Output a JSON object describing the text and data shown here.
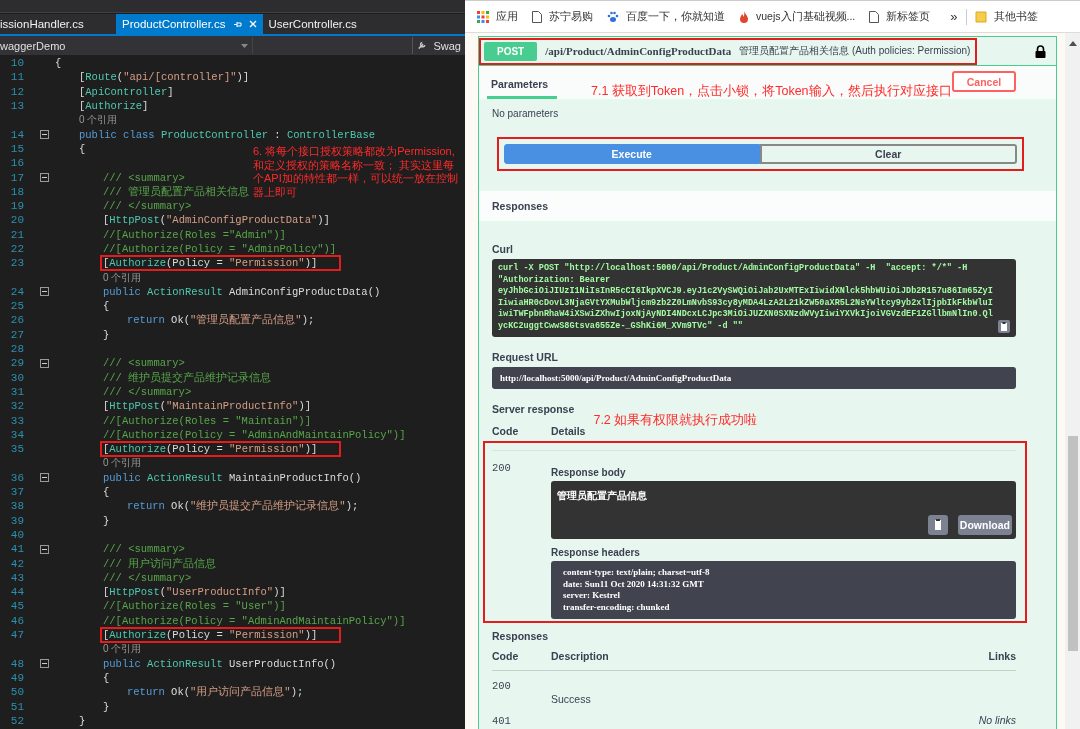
{
  "editor": {
    "tabs": [
      {
        "label": "issionHandler.cs",
        "selected": false
      },
      {
        "label": "ProductController.cs",
        "selected": true
      },
      {
        "label": "UserController.cs",
        "selected": false
      }
    ],
    "nav": {
      "project": "waggerDemo",
      "member": "Swag"
    },
    "note": "6. 将每个接口授权策略都改为Permission,和定义授权的策略名称一致； 其实这里每个API加的特性都一样，可以统一放在控制器上即可",
    "lines": [
      {
        "kind": "code",
        "number": "10",
        "fold": false,
        "highlighted": false,
        "tokens": [
          {
            "kind": "p",
            "text": "{"
          }
        ]
      },
      {
        "kind": "code",
        "number": "11",
        "fold": false,
        "highlighted": false,
        "tokens": [
          {
            "kind": "p",
            "text": "    ["
          },
          {
            "kind": "type",
            "text": "Route"
          },
          {
            "kind": "p",
            "text": "("
          },
          {
            "kind": "str",
            "text": "\"api/[controller]\""
          },
          {
            "kind": "p",
            "text": ")]"
          }
        ]
      },
      {
        "kind": "code",
        "number": "12",
        "fold": false,
        "highlighted": false,
        "tokens": [
          {
            "kind": "p",
            "text": "    ["
          },
          {
            "kind": "type",
            "text": "ApiController"
          },
          {
            "kind": "p",
            "text": "]"
          }
        ]
      },
      {
        "kind": "code",
        "number": "13",
        "fold": false,
        "highlighted": false,
        "tokens": [
          {
            "kind": "p",
            "text": "    ["
          },
          {
            "kind": "type",
            "text": "Authorize"
          },
          {
            "kind": "p",
            "text": "]"
          }
        ]
      },
      {
        "kind": "lens",
        "text": "    0 个引用"
      },
      {
        "kind": "code",
        "number": "14",
        "fold": true,
        "highlighted": false,
        "tokens": [
          {
            "kind": "kw",
            "text": "    public class "
          },
          {
            "kind": "type",
            "text": "ProductController"
          },
          {
            "kind": "p",
            "text": " : "
          },
          {
            "kind": "type",
            "text": "ControllerBase"
          }
        ]
      },
      {
        "kind": "code",
        "number": "15",
        "fold": false,
        "highlighted": false,
        "tokens": [
          {
            "kind": "p",
            "text": "    {"
          }
        ]
      },
      {
        "kind": "code",
        "number": "16",
        "fold": false,
        "highlighted": false
      },
      {
        "kind": "code",
        "number": "17",
        "fold": true,
        "highlighted": false,
        "tokens": [
          {
            "kind": "cm",
            "text": "        /// <summary>"
          }
        ]
      },
      {
        "kind": "code",
        "number": "18",
        "fold": false,
        "highlighted": false,
        "tokens": [
          {
            "kind": "cm",
            "text": "        /// 管理员配置产品相关信息"
          }
        ]
      },
      {
        "kind": "code",
        "number": "19",
        "fold": false,
        "highlighted": false,
        "tokens": [
          {
            "kind": "cm",
            "text": "        /// </summary>"
          }
        ]
      },
      {
        "kind": "code",
        "number": "20",
        "fold": false,
        "highlighted": false,
        "tokens": [
          {
            "kind": "p",
            "text": "        ["
          },
          {
            "kind": "type",
            "text": "HttpPost"
          },
          {
            "kind": "p",
            "text": "("
          },
          {
            "kind": "str",
            "text": "\"AdminConfigProductData\""
          },
          {
            "kind": "p",
            "text": ")]"
          }
        ]
      },
      {
        "kind": "code",
        "number": "21",
        "fold": false,
        "highlighted": false,
        "tokens": [
          {
            "kind": "cm",
            "text": "        //[Authorize(Roles =\"Admin\")]"
          }
        ]
      },
      {
        "kind": "code",
        "number": "22",
        "fold": false,
        "highlighted": false,
        "tokens": [
          {
            "kind": "cm",
            "text": "        //[Authorize(Policy = \"AdminPolicy\")]"
          }
        ]
      },
      {
        "kind": "code",
        "number": "23",
        "fold": false,
        "highlighted": true,
        "tokens": [
          {
            "kind": "p",
            "text": "        ["
          },
          {
            "kind": "type",
            "text": "Authorize"
          },
          {
            "kind": "p",
            "text": "(Policy = "
          },
          {
            "kind": "str",
            "text": "\"Permission\""
          },
          {
            "kind": "p",
            "text": ")]"
          }
        ]
      },
      {
        "kind": "lens",
        "text": "        0 个引用"
      },
      {
        "kind": "code",
        "number": "24",
        "fold": true,
        "highlighted": false,
        "tokens": [
          {
            "kind": "kw",
            "text": "        public "
          },
          {
            "kind": "type",
            "text": "ActionResult "
          },
          {
            "kind": "p",
            "text": "AdminConfigProductData()"
          }
        ]
      },
      {
        "kind": "code",
        "number": "25",
        "fold": false,
        "highlighted": false,
        "tokens": [
          {
            "kind": "p",
            "text": "        {"
          }
        ]
      },
      {
        "kind": "code",
        "number": "26",
        "fold": false,
        "highlighted": false,
        "tokens": [
          {
            "kind": "kw",
            "text": "            return "
          },
          {
            "kind": "p",
            "text": "Ok("
          },
          {
            "kind": "str",
            "text": "\"管理员配置产品信息\""
          },
          {
            "kind": "p",
            "text": ");"
          }
        ]
      },
      {
        "kind": "code",
        "number": "27",
        "fold": false,
        "highlighted": false,
        "tokens": [
          {
            "kind": "p",
            "text": "        }"
          }
        ]
      },
      {
        "kind": "code",
        "number": "28",
        "fold": false,
        "highlighted": false
      },
      {
        "kind": "code",
        "number": "29",
        "fold": true,
        "highlighted": false,
        "tokens": [
          {
            "kind": "cm",
            "text": "        /// <summary>"
          }
        ]
      },
      {
        "kind": "code",
        "number": "30",
        "fold": false,
        "highlighted": false,
        "tokens": [
          {
            "kind": "cm",
            "text": "        /// 维护员提交产品维护记录信息"
          }
        ]
      },
      {
        "kind": "code",
        "number": "31",
        "fold": false,
        "highlighted": false,
        "tokens": [
          {
            "kind": "cm",
            "text": "        /// </summary>"
          }
        ]
      },
      {
        "kind": "code",
        "number": "32",
        "fold": false,
        "highlighted": false,
        "tokens": [
          {
            "kind": "p",
            "text": "        ["
          },
          {
            "kind": "type",
            "text": "HttpPost"
          },
          {
            "kind": "p",
            "text": "("
          },
          {
            "kind": "str",
            "text": "\"MaintainProductInfo\""
          },
          {
            "kind": "p",
            "text": ")]"
          }
        ]
      },
      {
        "kind": "code",
        "number": "33",
        "fold": false,
        "highlighted": false,
        "tokens": [
          {
            "kind": "cm",
            "text": "        //[Authorize(Roles = \"Maintain\")]"
          }
        ]
      },
      {
        "kind": "code",
        "number": "34",
        "fold": false,
        "highlighted": false,
        "tokens": [
          {
            "kind": "cm",
            "text": "        //[Authorize(Policy = \"AdminAndMaintainPolicy\")]"
          }
        ]
      },
      {
        "kind": "code",
        "number": "35",
        "fold": false,
        "highlighted": true,
        "tokens": [
          {
            "kind": "p",
            "text": "        ["
          },
          {
            "kind": "type",
            "text": "Authorize"
          },
          {
            "kind": "p",
            "text": "(Policy = "
          },
          {
            "kind": "str",
            "text": "\"Permission\""
          },
          {
            "kind": "p",
            "text": ")]"
          }
        ]
      },
      {
        "kind": "lens",
        "text": "        0 个引用"
      },
      {
        "kind": "code",
        "number": "36",
        "fold": true,
        "highlighted": false,
        "tokens": [
          {
            "kind": "kw",
            "text": "        public "
          },
          {
            "kind": "type",
            "text": "ActionResult "
          },
          {
            "kind": "p",
            "text": "MaintainProductInfo()"
          }
        ]
      },
      {
        "kind": "code",
        "number": "37",
        "fold": false,
        "highlighted": false,
        "tokens": [
          {
            "kind": "p",
            "text": "        {"
          }
        ]
      },
      {
        "kind": "code",
        "number": "38",
        "fold": false,
        "highlighted": false,
        "tokens": [
          {
            "kind": "kw",
            "text": "            return "
          },
          {
            "kind": "p",
            "text": "Ok("
          },
          {
            "kind": "str",
            "text": "\"维护员提交产品维护记录信息\""
          },
          {
            "kind": "p",
            "text": ");"
          }
        ]
      },
      {
        "kind": "code",
        "number": "39",
        "fold": false,
        "highlighted": false,
        "tokens": [
          {
            "kind": "p",
            "text": "        }"
          }
        ]
      },
      {
        "kind": "code",
        "number": "40",
        "fold": false,
        "highlighted": false
      },
      {
        "kind": "code",
        "number": "41",
        "fold": true,
        "highlighted": false,
        "tokens": [
          {
            "kind": "cm",
            "text": "        /// <summary>"
          }
        ]
      },
      {
        "kind": "code",
        "number": "42",
        "fold": false,
        "highlighted": false,
        "tokens": [
          {
            "kind": "cm",
            "text": "        /// 用户访问产品信息"
          }
        ]
      },
      {
        "kind": "code",
        "number": "43",
        "fold": false,
        "highlighted": false,
        "tokens": [
          {
            "kind": "cm",
            "text": "        /// </summary>"
          }
        ]
      },
      {
        "kind": "code",
        "number": "44",
        "fold": false,
        "highlighted": false,
        "tokens": [
          {
            "kind": "p",
            "text": "        ["
          },
          {
            "kind": "type",
            "text": "HttpPost"
          },
          {
            "kind": "p",
            "text": "("
          },
          {
            "kind": "str",
            "text": "\"UserProductInfo\""
          },
          {
            "kind": "p",
            "text": ")]"
          }
        ]
      },
      {
        "kind": "code",
        "number": "45",
        "fold": false,
        "highlighted": false,
        "tokens": [
          {
            "kind": "cm",
            "text": "        //[Authorize(Roles = \"User\")]"
          }
        ]
      },
      {
        "kind": "code",
        "number": "46",
        "fold": false,
        "highlighted": false,
        "tokens": [
          {
            "kind": "cm",
            "text": "        //[Authorize(Policy = \"AdminAndMaintainPolicy\")]"
          }
        ]
      },
      {
        "kind": "code",
        "number": "47",
        "fold": false,
        "highlighted": true,
        "tokens": [
          {
            "kind": "p",
            "text": "        ["
          },
          {
            "kind": "type",
            "text": "Authorize"
          },
          {
            "kind": "p",
            "text": "(Policy = "
          },
          {
            "kind": "str",
            "text": "\"Permission\""
          },
          {
            "kind": "p",
            "text": ")]"
          }
        ]
      },
      {
        "kind": "lens",
        "text": "        0 个引用"
      },
      {
        "kind": "code",
        "number": "48",
        "fold": true,
        "highlighted": false,
        "tokens": [
          {
            "kind": "kw",
            "text": "        public "
          },
          {
            "kind": "type",
            "text": "ActionResult "
          },
          {
            "kind": "p",
            "text": "UserProductInfo()"
          }
        ]
      },
      {
        "kind": "code",
        "number": "49",
        "fold": false,
        "highlighted": false,
        "tokens": [
          {
            "kind": "p",
            "text": "        {"
          }
        ]
      },
      {
        "kind": "code",
        "number": "50",
        "fold": false,
        "highlighted": false,
        "tokens": [
          {
            "kind": "kw",
            "text": "            return "
          },
          {
            "kind": "p",
            "text": "Ok("
          },
          {
            "kind": "str",
            "text": "\"用户访问产品信息\""
          },
          {
            "kind": "p",
            "text": ");"
          }
        ]
      },
      {
        "kind": "code",
        "number": "51",
        "fold": false,
        "highlighted": false,
        "tokens": [
          {
            "kind": "p",
            "text": "        }"
          }
        ]
      },
      {
        "kind": "code",
        "number": "52",
        "fold": false,
        "highlighted": false,
        "tokens": [
          {
            "kind": "p",
            "text": "    }"
          }
        ]
      }
    ]
  },
  "browser": {
    "bookmarks": [
      {
        "label": "应用",
        "kind": "apps"
      },
      {
        "label": "苏宁易购",
        "kind": "page"
      },
      {
        "label": "百度一下，你就知道",
        "kind": "paw"
      },
      {
        "label": "vuejs入门基础视频...",
        "kind": "flame"
      },
      {
        "label": "新标签页",
        "kind": "page"
      }
    ],
    "overflow": "»",
    "folder": {
      "label": "其他书签",
      "kind": "folder"
    }
  },
  "operation": {
    "method": "POST",
    "path": "/api/Product/AdminConfigProductData",
    "summary": "管理员配置产品相关信息 (Auth policies: Permission)",
    "highlighted": true,
    "locked": true,
    "tabs": [
      {
        "label": "Parameters",
        "selected": true
      }
    ],
    "note": "7.1 获取到Token，点击小锁，将Token输入，然后执行对应接口",
    "cancel": "Cancel",
    "no_parameters": "No parameters",
    "actions": {
      "highlighted": true,
      "execute": "Execute",
      "clear": "Clear"
    }
  },
  "responses_header": "Responses",
  "curl": {
    "label": "Curl",
    "lines": [
      "curl -X POST \"http://localhost:5000/api/Product/AdminConfigProductData\" -H  \"accept: */*\" -H",
      "\"Authorization: Bearer",
      "eyJhbGciOiJIUzI1NiIsInR5cCI6IkpXVCJ9.eyJ1c2VySWQiOiJab2UxMTExIiwidXNlck5hbWUiOiJDb2R157u86Im65ZyI",
      "IiwiaHR0cDovL3NjaGVtYXMubWljcm9zb2Z0LmNvbS93cy8yMDA4LzA2L21kZW50aXR5L2NsYWltcy9yb2xlIjpbIkFkbWluI",
      "iwiTWFpbnRhaW4iXSwiZXhwIjoxNjAyNDI4NDcxLCJpc3MiOiJUZXN0SXNzdWVyIiwiYXVkIjoiVGVzdEF1ZGllbmNlIn0.Ql",
      "ycKC2uggtCwwS8Gtsva655Ze-_GShKi6M_XVm9TVc\" -d \"\""
    ]
  },
  "request_url": {
    "label": "Request URL",
    "value": "http://localhost:5000/api/Product/AdminConfigProductData"
  },
  "server_response": {
    "label": "Server response",
    "columns": [
      "Code",
      "Details"
    ],
    "note": "7.2 如果有权限就执行成功啦",
    "highlighted": true,
    "code": "200",
    "body_label": "Response body",
    "body": "管理员配置产品信息",
    "download": "Download",
    "headers_label": "Response headers",
    "headers": [
      "content-type: text/plain; charset=utf-8",
      "date: Sun11 Oct 2020 14:31:32 GMT",
      "server: Kestrel",
      "transfer-encoding: chunked"
    ]
  },
  "responses": {
    "label": "Responses",
    "columns": [
      "Code",
      "Description",
      "Links"
    ],
    "rows": [
      {
        "code": "200",
        "description": "Success"
      },
      {
        "code": "401",
        "links": "No links"
      }
    ]
  }
}
